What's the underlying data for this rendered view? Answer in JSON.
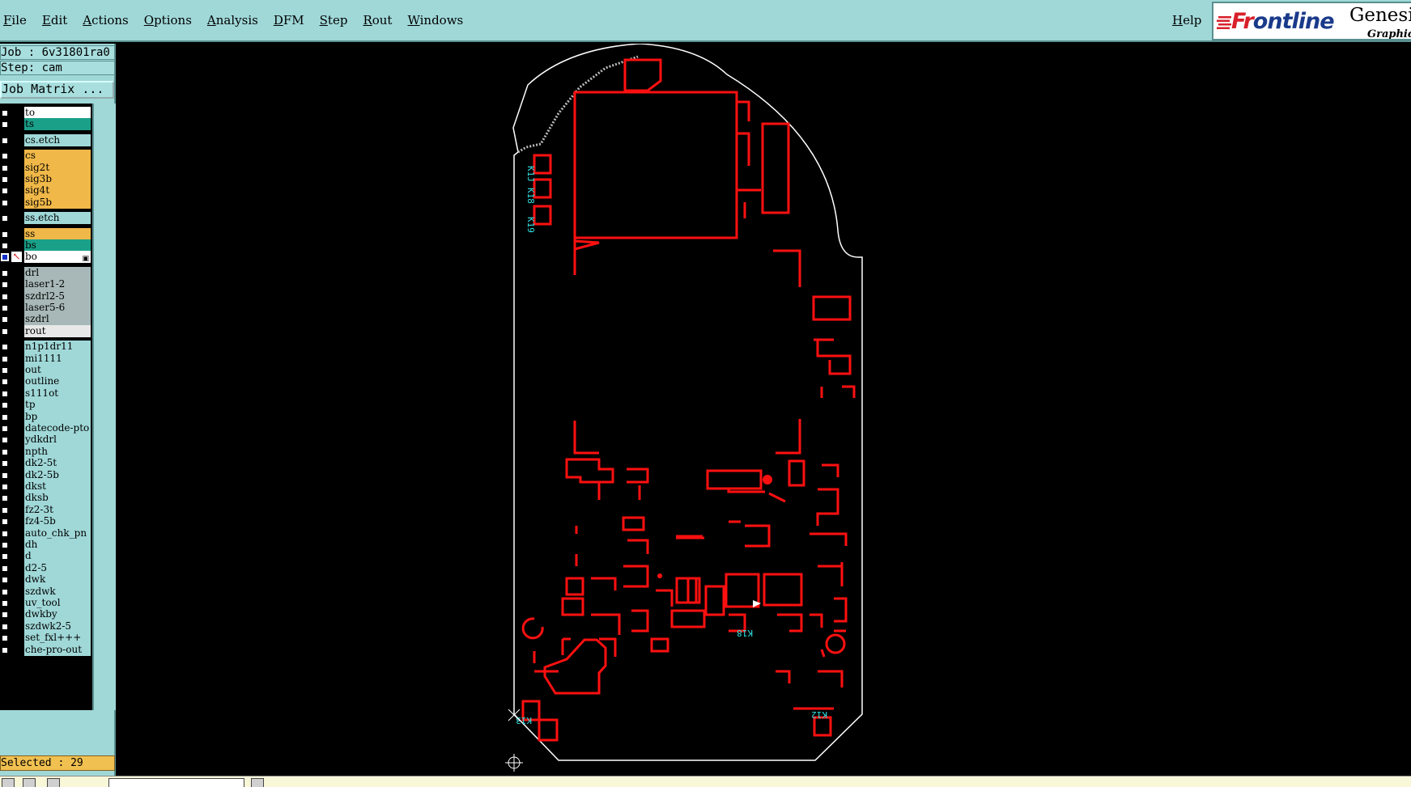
{
  "menubar": {
    "menus": [
      "File",
      "Edit",
      "Actions",
      "Options",
      "Analysis",
      "DFM",
      "Step",
      "Rout",
      "Windows"
    ],
    "help": "Help",
    "brand": {
      "logo_text_red": "Fr",
      "logo_text_rest": "ontline",
      "product": "Genesis",
      "tagline": "Graphic E"
    }
  },
  "job_info": {
    "job_line": "Job : 6v31801ra0",
    "step_line": "Step: cam",
    "job_matrix_button": "Job Matrix ..."
  },
  "layers": [
    {
      "name": "to",
      "color": "#ffffff"
    },
    {
      "name": "ts",
      "color": "#1aa088"
    },
    {
      "name": "cs.etch",
      "color": "#a0d8d8"
    },
    {
      "name": "cs",
      "color": "#f0b848"
    },
    {
      "name": "sig2t",
      "color": "#f0b848"
    },
    {
      "name": "sig3b",
      "color": "#f0b848"
    },
    {
      "name": "sig4t",
      "color": "#f0b848"
    },
    {
      "name": "sig5b",
      "color": "#f0b848"
    },
    {
      "name": "ss.etch",
      "color": "#a0d8d8"
    },
    {
      "name": "ss",
      "color": "#f0b848"
    },
    {
      "name": "bs",
      "color": "#1aa088"
    },
    {
      "name": "bo",
      "color": "#ffffff",
      "active": true
    },
    {
      "name": "drl",
      "color": "#a8b8b8"
    },
    {
      "name": "laser1-2",
      "color": "#a8b8b8"
    },
    {
      "name": "szdrl2-5",
      "color": "#a8b8b8"
    },
    {
      "name": "laser5-6",
      "color": "#a8b8b8"
    },
    {
      "name": "szdrl",
      "color": "#a8b8b8"
    },
    {
      "name": "rout",
      "color": "#e8e8e8"
    },
    {
      "name": "n1p1dr11",
      "color": "#a0d8d8"
    },
    {
      "name": "mi1111",
      "color": "#a0d8d8"
    },
    {
      "name": "out",
      "color": "#a0d8d8"
    },
    {
      "name": "outline",
      "color": "#a0d8d8"
    },
    {
      "name": "s111ot",
      "color": "#a0d8d8"
    },
    {
      "name": "tp",
      "color": "#a0d8d8"
    },
    {
      "name": "bp",
      "color": "#a0d8d8"
    },
    {
      "name": "datecode-pto",
      "color": "#a0d8d8"
    },
    {
      "name": "ydkdrl",
      "color": "#a0d8d8"
    },
    {
      "name": "npth",
      "color": "#a0d8d8"
    },
    {
      "name": "dk2-5t",
      "color": "#a0d8d8"
    },
    {
      "name": "dk2-5b",
      "color": "#a0d8d8"
    },
    {
      "name": "dkst",
      "color": "#a0d8d8"
    },
    {
      "name": "dksb",
      "color": "#a0d8d8"
    },
    {
      "name": "fz2-3t",
      "color": "#a0d8d8"
    },
    {
      "name": "fz4-5b",
      "color": "#a0d8d8"
    },
    {
      "name": "auto_chk_pn",
      "color": "#a0d8d8"
    },
    {
      "name": "dh",
      "color": "#a0d8d8"
    },
    {
      "name": "d",
      "color": "#a0d8d8"
    },
    {
      "name": "d2-5",
      "color": "#a0d8d8"
    },
    {
      "name": "dwk",
      "color": "#a0d8d8"
    },
    {
      "name": "szdwk",
      "color": "#a0d8d8"
    },
    {
      "name": "uv_tool",
      "color": "#a0d8d8"
    },
    {
      "name": "dwkby",
      "color": "#a0d8d8"
    },
    {
      "name": "szdwk2-5",
      "color": "#a0d8d8"
    },
    {
      "name": "set_fxl+++",
      "color": "#a0d8d8"
    },
    {
      "name": "che-pro-out",
      "color": "#a0d8d8"
    }
  ],
  "selected": "Selected : 29",
  "canvas": {
    "pad_labels": [
      "K1J",
      "K18",
      "K19",
      "K13",
      "K12"
    ],
    "colors": {
      "outline": "#ffffff",
      "features": "#ff1010",
      "labels": "#30e0e0"
    }
  }
}
